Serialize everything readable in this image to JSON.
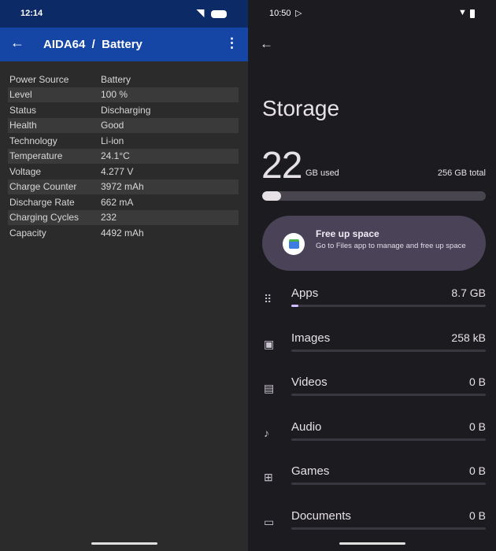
{
  "left": {
    "status": {
      "time": "12:14"
    },
    "appbar": {
      "title": "AIDA64  /  Battery"
    },
    "rows": [
      [
        "Power Source",
        "Battery"
      ],
      [
        "Level",
        "100 %"
      ],
      [
        "Status",
        "Discharging"
      ],
      [
        "Health",
        "Good"
      ],
      [
        "Technology",
        "Li-ion"
      ],
      [
        "Temperature",
        "24.1°C"
      ],
      [
        "Voltage",
        "4.277 V"
      ],
      [
        "Charge Counter",
        "3972 mAh"
      ],
      [
        "Discharge Rate",
        "662 mA"
      ],
      [
        "Charging Cycles",
        "232"
      ],
      [
        "Capacity",
        "4492 mAh"
      ]
    ]
  },
  "right": {
    "status": {
      "time": "10:50"
    },
    "title": "Storage",
    "used_value": "22",
    "used_label": "GB used",
    "total": "256 GB total",
    "used_fraction": 0.086,
    "card": {
      "title": "Free up space",
      "subtitle": "Go to Files app to manage and free up space"
    },
    "categories": [
      {
        "name": "Apps",
        "value": "8.7 GB",
        "fraction": 0.035,
        "icon": "apps-grid-icon"
      },
      {
        "name": "Images",
        "value": "258 kB",
        "fraction": 0,
        "icon": "image-icon"
      },
      {
        "name": "Videos",
        "value": "0 B",
        "fraction": 0,
        "icon": "movie-icon"
      },
      {
        "name": "Audio",
        "value": "0 B",
        "fraction": 0,
        "icon": "music-note-icon"
      },
      {
        "name": "Games",
        "value": "0 B",
        "fraction": 0,
        "icon": "gamepad-icon"
      },
      {
        "name": "Documents",
        "value": "0 B",
        "fraction": 0,
        "icon": "folder-icon"
      }
    ]
  }
}
